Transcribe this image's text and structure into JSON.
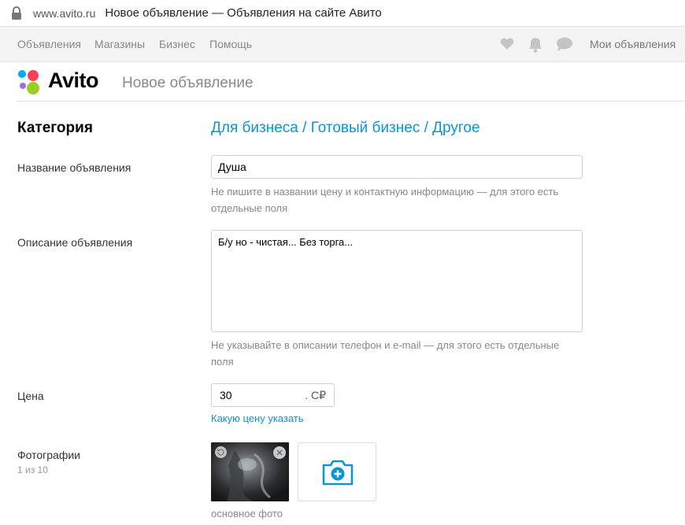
{
  "browser": {
    "url": "www.avito.ru",
    "title": "Новое объявление — Объявления на сайте Авито"
  },
  "topnav": {
    "links": [
      "Объявления",
      "Магазины",
      "Бизнес",
      "Помощь"
    ],
    "my_ads": "Мои объявления",
    "icons": [
      "heart-icon",
      "bell-icon",
      "chat-icon"
    ]
  },
  "header": {
    "logo": "Avito",
    "page_title": "Новое объявление"
  },
  "form": {
    "category": {
      "label": "Категория",
      "value": "Для бизнеса / Готовый бизнес / Другое"
    },
    "title": {
      "label": "Название объявления",
      "value": "Душа",
      "hint": "Не пишите в названии цену и контактную информацию — для этого есть отдельные поля"
    },
    "description": {
      "label": "Описание объявления",
      "value": "Б/у но - чистая... Без торга...",
      "hint": "Не указывайте в описании телефон и e-mail — для этого есть отдельные поля"
    },
    "price": {
      "label": "Цена",
      "value": "30",
      "currency": ". С₽",
      "link": "Какую цену указать"
    },
    "photos": {
      "label": "Фотографии",
      "count": "1 из 10",
      "main_label": "основное фото"
    }
  },
  "colors": {
    "accent_blue": "#0a95d6",
    "logo_blue": "#0af",
    "logo_red": "#ff4053",
    "logo_green": "#97cf26",
    "logo_purple": "#a169f7"
  }
}
